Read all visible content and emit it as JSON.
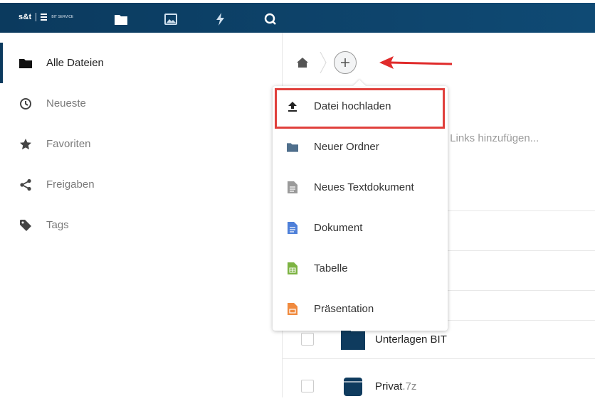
{
  "header": {
    "brand": "s&t",
    "brand_small": "BIT SERVICE",
    "apps": [
      {
        "name": "files-app",
        "icon": "folder-icon",
        "active": true
      },
      {
        "name": "photos-app",
        "icon": "image-icon",
        "active": false
      },
      {
        "name": "activity-app",
        "icon": "lightning-icon",
        "active": false
      },
      {
        "name": "search-app",
        "icon": "search-icon",
        "active": false
      }
    ]
  },
  "sidebar": {
    "items": [
      {
        "label": "Alle Dateien",
        "icon": "folder-icon",
        "active": true
      },
      {
        "label": "Neueste",
        "icon": "clock-icon",
        "active": false
      },
      {
        "label": "Favoriten",
        "icon": "star-icon",
        "active": false
      },
      {
        "label": "Freigaben",
        "icon": "share-icon",
        "active": false
      },
      {
        "label": "Tags",
        "icon": "tag-icon",
        "active": false
      }
    ]
  },
  "main": {
    "breadcrumb_home_icon": "home-icon",
    "add_button_icon": "plus-icon",
    "background_text": "r Links hinzufügen...",
    "files": [
      {
        "name": "Unterlagen BIT",
        "ext": "",
        "icon": "folder-icon"
      },
      {
        "name": "Privat",
        "ext": ".7z",
        "icon": "archive-icon"
      }
    ]
  },
  "new_menu": {
    "items": [
      {
        "label": "Datei hochladen",
        "icon": "upload-icon",
        "highlighted": true
      },
      {
        "label": "Neuer Ordner",
        "icon": "folder-icon"
      },
      {
        "label": "Neues Textdokument",
        "icon": "text-file-icon"
      },
      {
        "label": "Dokument",
        "icon": "document-icon"
      },
      {
        "label": "Tabelle",
        "icon": "spreadsheet-icon"
      },
      {
        "label": "Präsentation",
        "icon": "presentation-icon"
      }
    ]
  },
  "colors": {
    "header": "#0b3a5e",
    "highlight": "#e0403c",
    "arrow": "#e02b2b",
    "folder": "#0f3b5e"
  }
}
